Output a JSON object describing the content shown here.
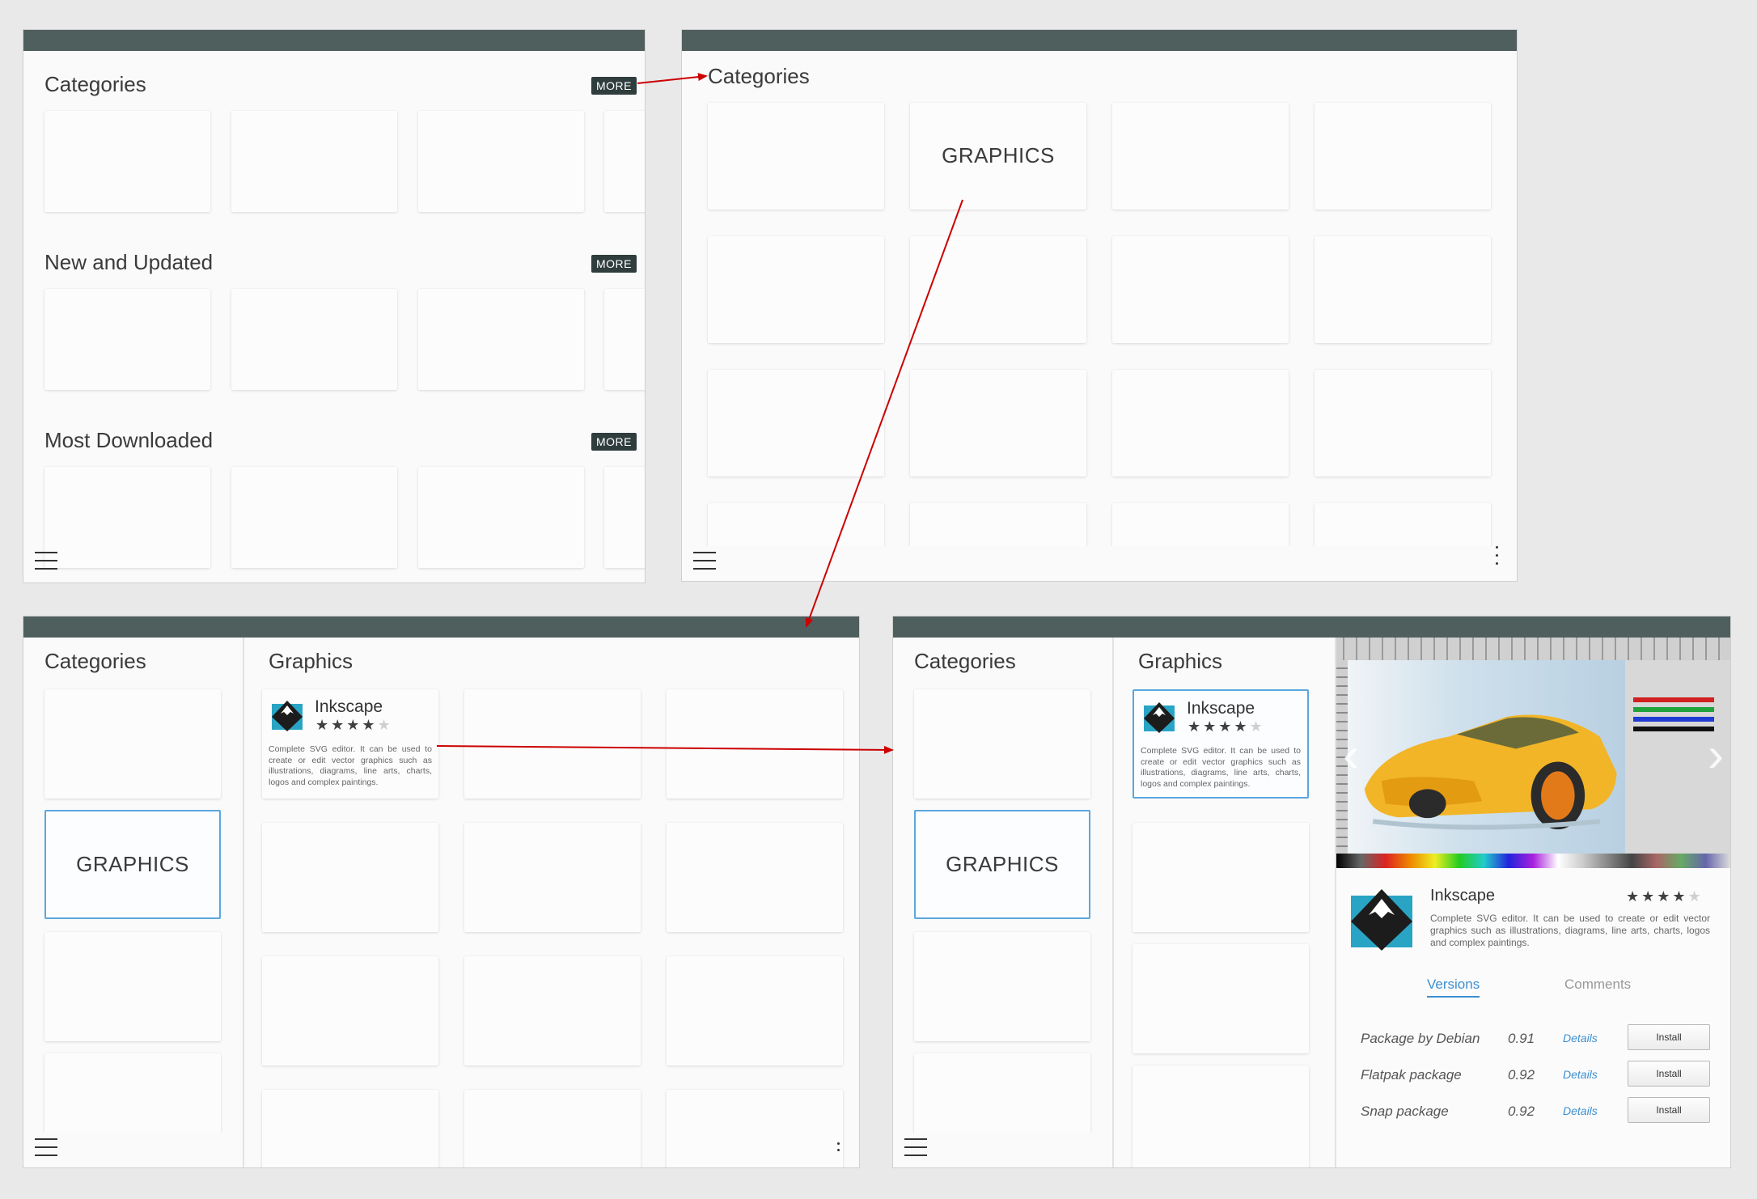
{
  "panel1": {
    "sections": [
      {
        "title": "Categories",
        "more": "MORE"
      },
      {
        "title": "New and Updated",
        "more": "MORE"
      },
      {
        "title": "Most Downloaded",
        "more": "MORE"
      }
    ]
  },
  "panel2": {
    "title": "Categories",
    "graphics_label": "GRAPHICS"
  },
  "panel3": {
    "sidebar_title": "Categories",
    "graphics_label": "GRAPHICS",
    "main_title": "Graphics",
    "app": {
      "name": "Inkscape",
      "rating": 4,
      "description": "Complete SVG editor. It can be used to create or edit vector graphics such as illustrations, diagrams, line arts, charts, logos and complex paintings."
    }
  },
  "panel4": {
    "sidebar_title": "Categories",
    "graphics_label": "GRAPHICS",
    "main_title": "Graphics",
    "app": {
      "name": "Inkscape",
      "rating": 4,
      "description": "Complete SVG editor. It can be used to create or edit vector graphics such as illustrations, diagrams, line arts, charts, logos and complex paintings."
    },
    "detail": {
      "name": "Inkscape",
      "rating": 4,
      "description": "Complete SVG editor. It can be used to create or edit vector graphics such as illustrations, diagrams, line arts, charts, logos and complex paintings.",
      "tabs": [
        "Versions",
        "Comments"
      ],
      "versions": [
        {
          "package": "Package by Debian",
          "version": "0.91",
          "details": "Details",
          "install": "Install"
        },
        {
          "package": "Flatpak package",
          "version": "0.92",
          "details": "Details",
          "install": "Install"
        },
        {
          "package": "Snap package",
          "version": "0.92",
          "details": "Details",
          "install": "Install"
        }
      ]
    }
  },
  "colors": {
    "titlebar": "#4f5f5e",
    "more_button": "#2f3d3c",
    "selection": "#5aa7de",
    "link": "#3d8fd1",
    "arrow": "#cc0000"
  },
  "icons": [
    "hamburger-menu-icon",
    "kebab-menu-icon",
    "inkscape-app-icon",
    "star-icon",
    "chevron-left-icon",
    "chevron-right-icon"
  ]
}
